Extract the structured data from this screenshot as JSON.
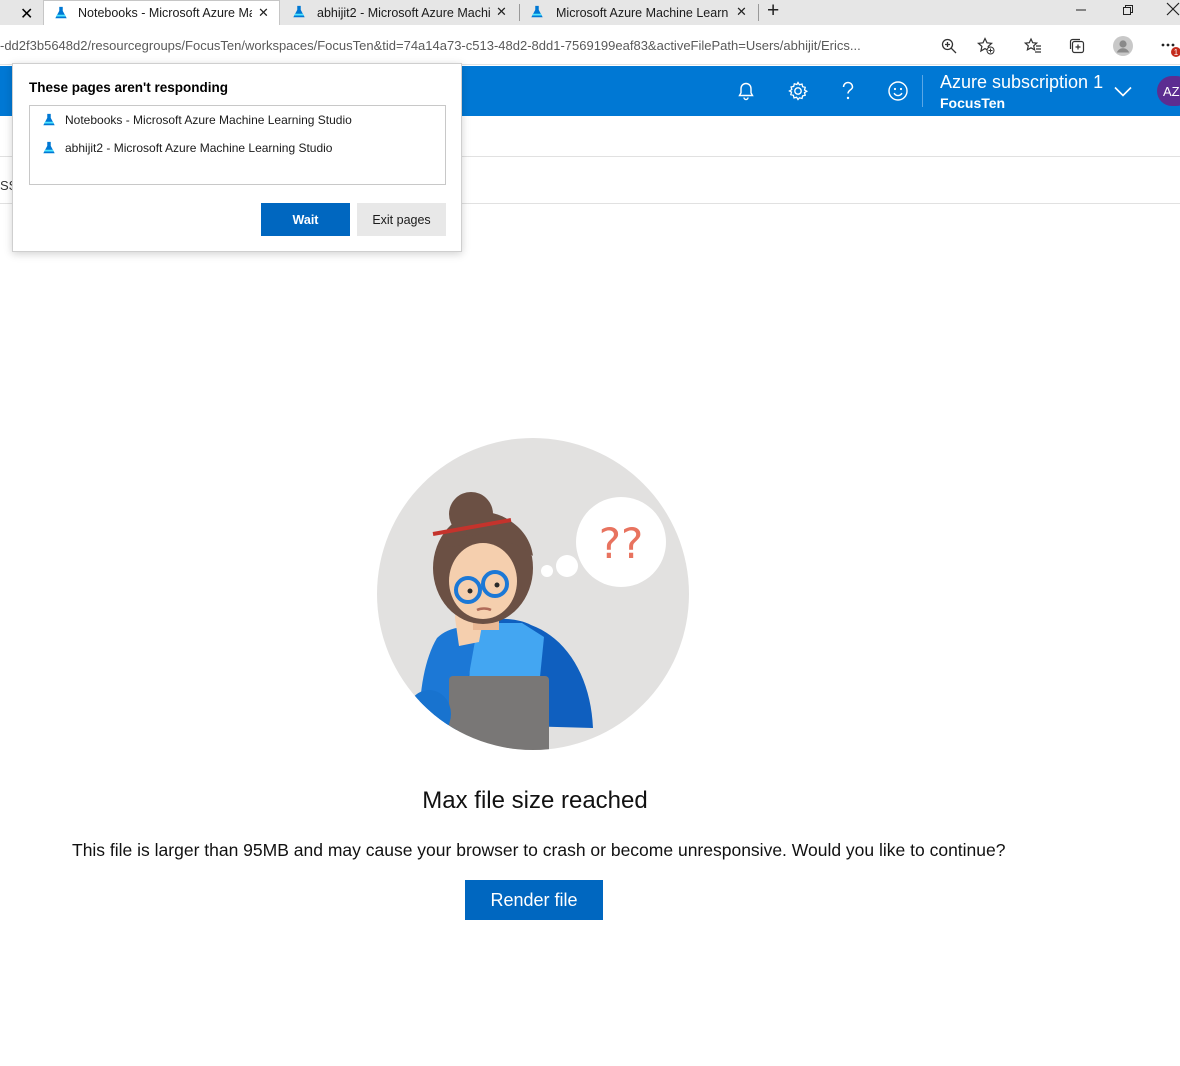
{
  "browser": {
    "tabs": [
      {
        "title": "Notebooks - Microsoft Azure Ma"
      },
      {
        "title": "abhijit2 - Microsoft Azure Machi"
      },
      {
        "title": "Microsoft Azure Machine Learnir"
      }
    ],
    "new_tab_glyph": "+",
    "close_glyph": "✕",
    "url": "-dd2f3b5648d2/resourcegroups/FocusTen/workspaces/FocusTen&tid=74a14a73-c513-48d2-8dd1-7569199eaf83&activeFilePath=Users/abhijit/Erics...",
    "notification_badge": "1"
  },
  "azure_header": {
    "subscription": "Azure subscription 1",
    "workspace": "FocusTen",
    "avatar_initials": "AZ"
  },
  "partial_text": "SS",
  "dialog": {
    "title": "These pages aren't responding",
    "pages": [
      {
        "title": "Notebooks - Microsoft Azure Machine Learning Studio"
      },
      {
        "title": "abhijit2 - Microsoft Azure Machine Learning Studio"
      }
    ],
    "wait_label": "Wait",
    "exit_label": "Exit pages"
  },
  "illustration": {
    "thought_text": "??"
  },
  "content": {
    "heading": "Max file size reached",
    "message": "This file is larger than 95MB and may cause your browser to crash or become unresponsive. Would you like to continue?",
    "render_label": "Render file"
  },
  "colors": {
    "azure_blue": "#0078d4",
    "button_blue": "#0067c0"
  }
}
